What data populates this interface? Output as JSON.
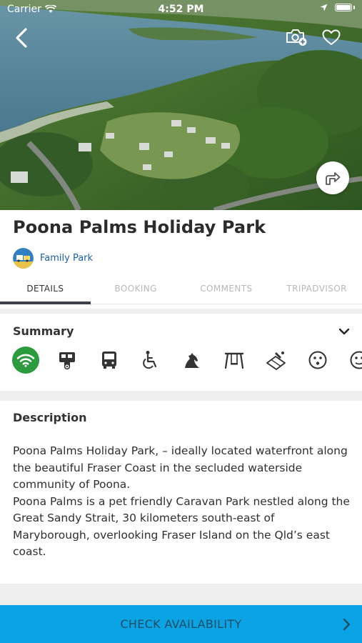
{
  "status_bar": {
    "carrier": "Carrier",
    "time": "4:52 PM"
  },
  "hero": {
    "icons": [
      "back-arrow-icon",
      "add-photo-camera-icon",
      "heart-icon",
      "share-icon"
    ]
  },
  "park": {
    "name": "Poona Palms Holiday Park",
    "category": "Family Park"
  },
  "tabs": [
    {
      "label": "DETAILS",
      "active": true
    },
    {
      "label": "BOOKING",
      "active": false
    },
    {
      "label": "COMMENTS",
      "active": false
    },
    {
      "label": "TRIPADVISOR",
      "active": false
    }
  ],
  "summary": {
    "title": "Summary",
    "amenities": [
      "wifi-icon",
      "caravan-icon",
      "bus-icon",
      "wheelchair-icon",
      "horse-icon",
      "playground-swing-icon",
      "tennis-icon",
      "smiley-face-icon",
      "face-icon"
    ]
  },
  "description": {
    "title": "Description",
    "paragraph1": "Poona Palms Holiday Park, – ideally located waterfront along the beautiful Fraser Coast in the secluded waterside community of Poona.",
    "paragraph2": "Poona Palms is a pet friendly Caravan Park nestled along the Great Sandy Strait, 30 kilometers south-east of Maryborough, overlooking Fraser Island on the Qld’s east coast."
  },
  "cta": {
    "label": "CHECK AVAILABILITY"
  },
  "colors": {
    "cta": "#0aa3e3",
    "wifi_badge": "#2c9b3e",
    "category_link": "#1b5fb0",
    "tab_indicator": "#3a3f4a"
  }
}
